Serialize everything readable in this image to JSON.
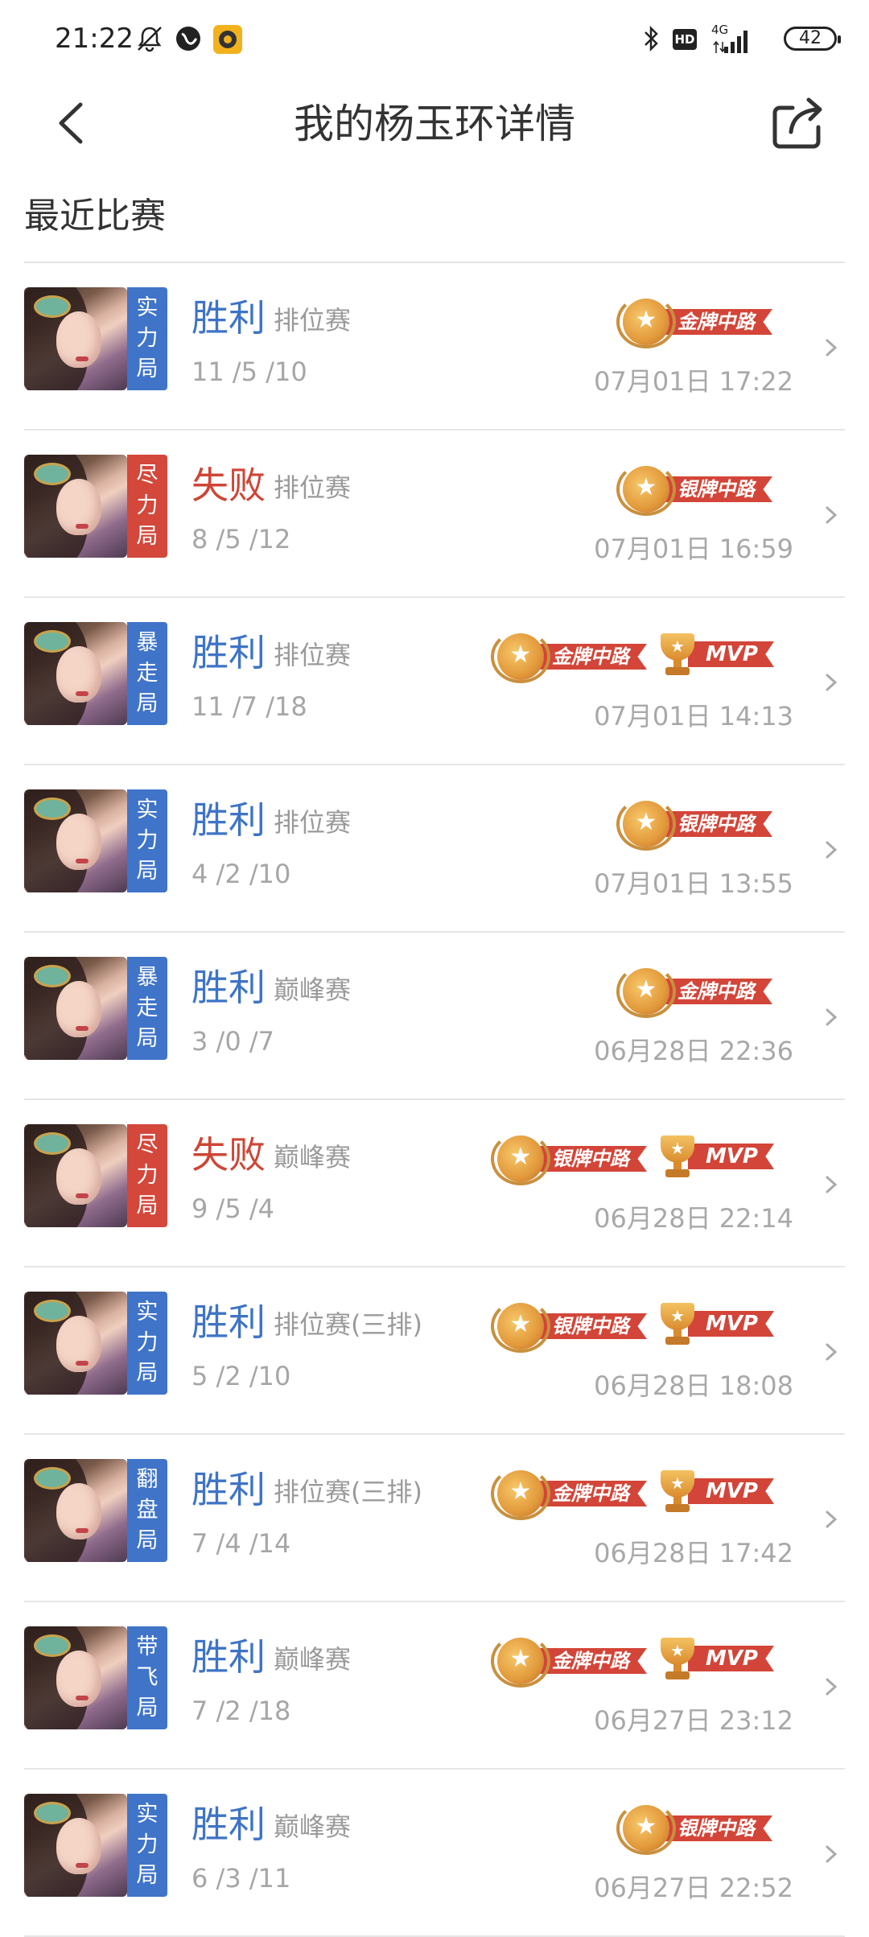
{
  "status_bar": {
    "time": "21:22",
    "battery": "42",
    "network": "4G",
    "hd": "HD"
  },
  "header": {
    "title": "我的杨玉环详情"
  },
  "section": {
    "title": "最近比赛"
  },
  "matches": [
    {
      "tag": "实力局",
      "tag_color": "blue",
      "result": "胜利",
      "outcome": "win",
      "mode": "排位赛",
      "kda": "11 /5 /10",
      "date": "07月01日 17:22",
      "medal_label": "金牌中路",
      "mvp": false
    },
    {
      "tag": "尽力局",
      "tag_color": "red",
      "result": "失败",
      "outcome": "loss",
      "mode": "排位赛",
      "kda": "8 /5 /12",
      "date": "07月01日 16:59",
      "medal_label": "银牌中路",
      "mvp": false
    },
    {
      "tag": "暴走局",
      "tag_color": "blue",
      "result": "胜利",
      "outcome": "win",
      "mode": "排位赛",
      "kda": "11 /7 /18",
      "date": "07月01日 14:13",
      "medal_label": "金牌中路",
      "mvp": true
    },
    {
      "tag": "实力局",
      "tag_color": "blue",
      "result": "胜利",
      "outcome": "win",
      "mode": "排位赛",
      "kda": "4 /2 /10",
      "date": "07月01日 13:55",
      "medal_label": "银牌中路",
      "mvp": false
    },
    {
      "tag": "暴走局",
      "tag_color": "blue",
      "result": "胜利",
      "outcome": "win",
      "mode": "巅峰赛",
      "kda": "3 /0 /7",
      "date": "06月28日 22:36",
      "medal_label": "金牌中路",
      "mvp": false
    },
    {
      "tag": "尽力局",
      "tag_color": "red",
      "result": "失败",
      "outcome": "loss",
      "mode": "巅峰赛",
      "kda": "9 /5 /4",
      "date": "06月28日 22:14",
      "medal_label": "银牌中路",
      "mvp": true
    },
    {
      "tag": "实力局",
      "tag_color": "blue",
      "result": "胜利",
      "outcome": "win",
      "mode": "排位赛(三排)",
      "kda": "5 /2 /10",
      "date": "06月28日 18:08",
      "medal_label": "银牌中路",
      "mvp": true
    },
    {
      "tag": "翻盘局",
      "tag_color": "blue",
      "result": "胜利",
      "outcome": "win",
      "mode": "排位赛(三排)",
      "kda": "7 /4 /14",
      "date": "06月28日 17:42",
      "medal_label": "金牌中路",
      "mvp": true
    },
    {
      "tag": "带飞局",
      "tag_color": "blue",
      "result": "胜利",
      "outcome": "win",
      "mode": "巅峰赛",
      "kda": "7 /2 /18",
      "date": "06月27日 23:12",
      "medal_label": "金牌中路",
      "mvp": true
    },
    {
      "tag": "实力局",
      "tag_color": "blue",
      "result": "胜利",
      "outcome": "win",
      "mode": "巅峰赛",
      "kda": "6 /3 /11",
      "date": "06月27日 22:52",
      "medal_label": "银牌中路",
      "mvp": false
    }
  ],
  "mvp_label": "MVP",
  "icons": {
    "back": "chevron-left-icon",
    "share": "share-icon",
    "row_arrow": "chevron-right-icon"
  }
}
